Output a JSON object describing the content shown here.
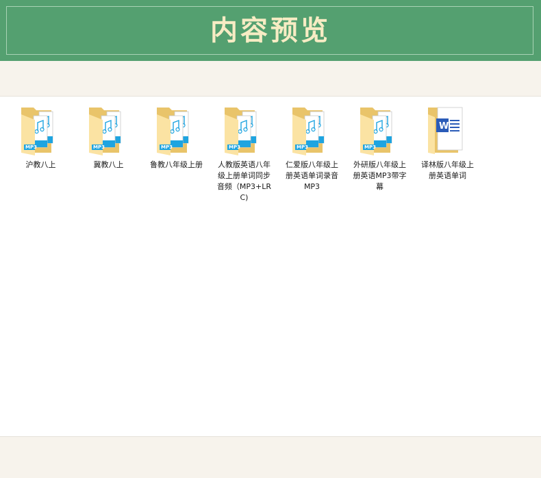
{
  "header": {
    "title": "内容预览"
  },
  "folder": {
    "items": [
      {
        "label": "沪教八上",
        "content": "mp3"
      },
      {
        "label": "冀教八上",
        "content": "mp3"
      },
      {
        "label": "鲁教八年级上册",
        "content": "mp3"
      },
      {
        "label": "人教版英语八年级上册单词同步音频（MP3+LRC)",
        "content": "mp3"
      },
      {
        "label": "仁爱版八年级上册英语单词录音MP3",
        "content": "mp3"
      },
      {
        "label": "外研版八年级上册英语MP3带字幕",
        "content": "mp3"
      },
      {
        "label": "译林版八年级上册英语单词",
        "content": "word"
      }
    ],
    "badge_text": "MP3",
    "word_letter": "W"
  },
  "colors": {
    "banner": "#54a070",
    "title": "#f7ecc4",
    "folder_back": "#e9c46a",
    "folder_front": "#fbe3a3",
    "mp3_blue": "#1ea4e0",
    "word_blue": "#2a5bb8",
    "background": "#f7f3ec"
  },
  "icons": [
    "folder-mp3-icon",
    "folder-word-icon"
  ]
}
